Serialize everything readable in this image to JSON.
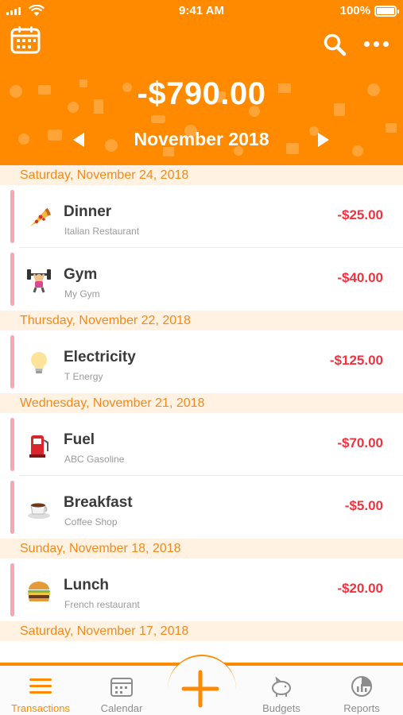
{
  "status_bar": {
    "time": "9:41 AM",
    "battery": "100%"
  },
  "header": {
    "total": "-$790.00",
    "month": "November 2018",
    "icons": {
      "calendar": "calendar-icon",
      "search": "search-icon",
      "more": "more-icon"
    }
  },
  "days": [
    {
      "date": "Saturday, November 24, 2018",
      "items": [
        {
          "title": "Dinner",
          "sub": "Italian Restaurant",
          "amount": "-$25.00",
          "icon": "pizza-icon"
        },
        {
          "title": "Gym",
          "sub": "My Gym",
          "amount": "-$40.00",
          "icon": "weightlifter-icon"
        }
      ]
    },
    {
      "date": "Thursday, November 22, 2018",
      "items": [
        {
          "title": "Electricity",
          "sub": "T Energy",
          "amount": "-$125.00",
          "icon": "lightbulb-icon"
        }
      ]
    },
    {
      "date": "Wednesday, November 21, 2018",
      "items": [
        {
          "title": "Fuel",
          "sub": "ABC Gasoline",
          "amount": "-$70.00",
          "icon": "fuel-pump-icon"
        },
        {
          "title": "Breakfast",
          "sub": "Coffee Shop",
          "amount": "-$5.00",
          "icon": "coffee-icon"
        }
      ]
    },
    {
      "date": "Sunday, November 18, 2018",
      "items": [
        {
          "title": "Lunch",
          "sub": "French restaurant",
          "amount": "-$20.00",
          "icon": "burger-icon"
        }
      ]
    },
    {
      "date": "Saturday, November 17, 2018",
      "items": []
    }
  ],
  "tabbar": {
    "tabs": [
      {
        "label": "Transactions",
        "icon": "list-icon",
        "active": true
      },
      {
        "label": "Calendar",
        "icon": "calendar-icon",
        "active": false
      },
      {
        "label": "Budgets",
        "icon": "piggy-bank-icon",
        "active": false
      },
      {
        "label": "Reports",
        "icon": "pie-chart-icon",
        "active": false
      }
    ],
    "add_icon": "plus-icon"
  },
  "colors": {
    "accent": "#ff8a00",
    "expense": "#f2323c",
    "date_header_bg": "#fff2e2",
    "row_marker": "#f9a7ae"
  }
}
